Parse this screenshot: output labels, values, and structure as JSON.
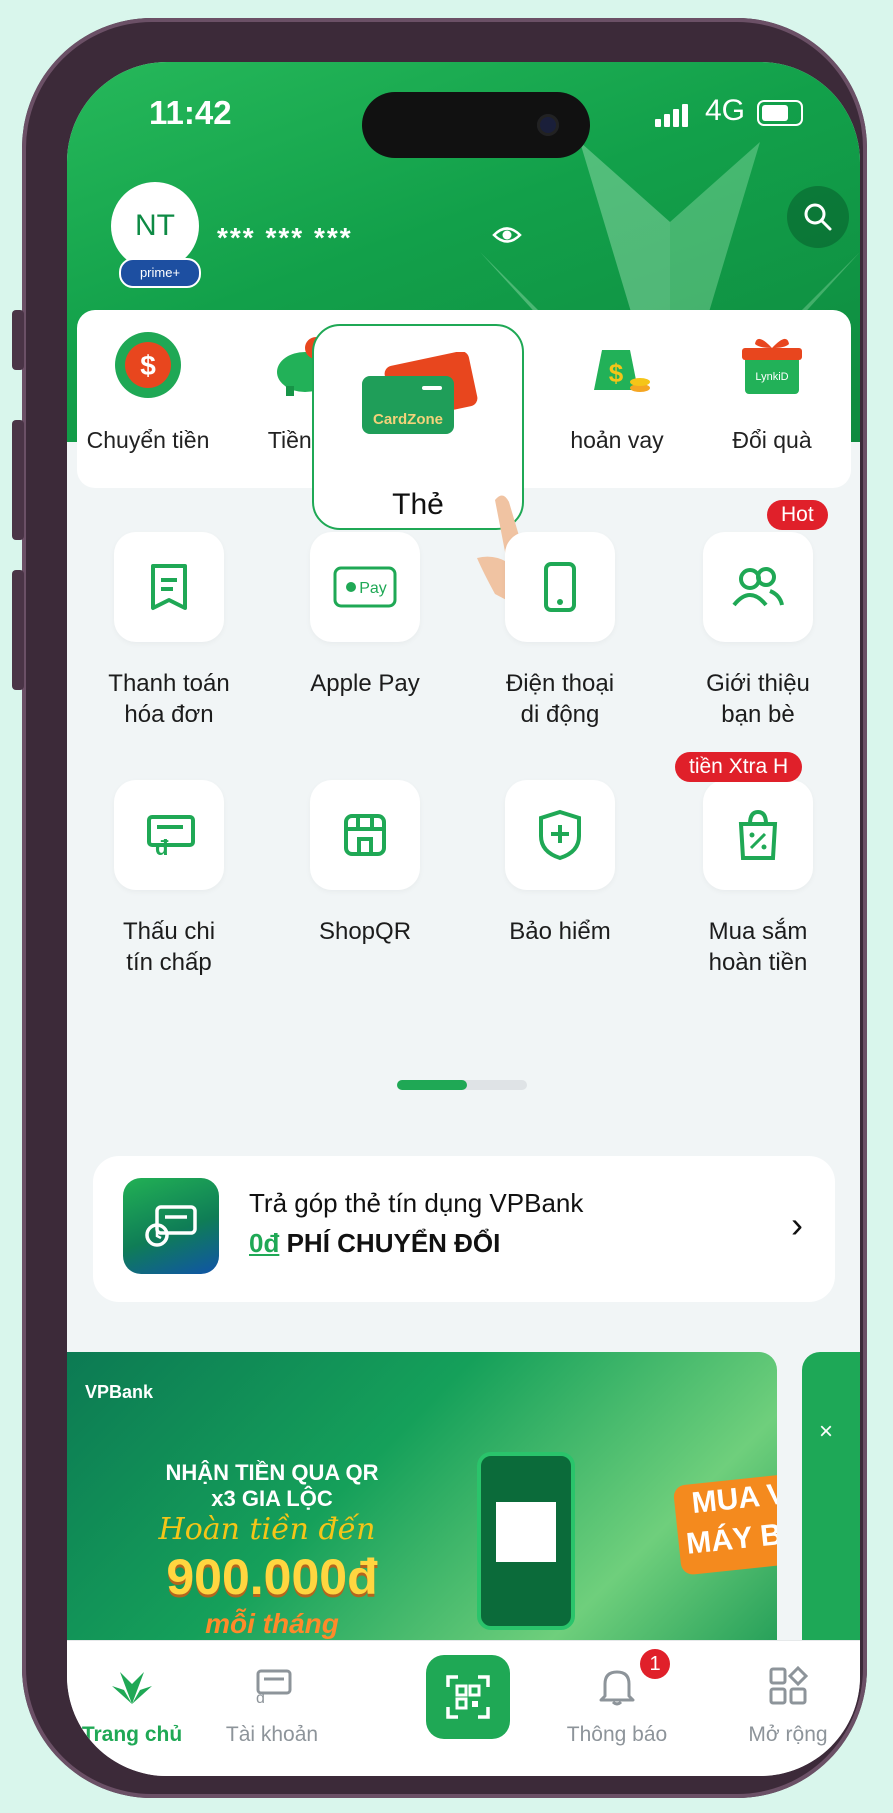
{
  "status_bar": {
    "time": "11:42",
    "network": "4G"
  },
  "header": {
    "avatar_initials": "NT",
    "prime_badge": "prime+",
    "balance_masked": "*** *** ***"
  },
  "quick_actions": [
    {
      "label": "Chuyển tiền",
      "icon": "transfer-icon"
    },
    {
      "label": "Tiền gử",
      "icon": "piggy-bank-icon"
    },
    {
      "label": "hoản vay",
      "icon": "money-bag-icon"
    },
    {
      "label": "Đổi quà",
      "icon": "gift-icon"
    }
  ],
  "card_popup": {
    "label": "Thẻ",
    "card_text": "CardZone"
  },
  "services": [
    {
      "label": "Thanh toán\nhóa đơn",
      "icon": "receipt-icon"
    },
    {
      "label": "Apple Pay",
      "icon": "apple-pay-icon",
      "icon_text": "Pay"
    },
    {
      "label": "Điện thoại\ndi động",
      "icon": "phone-icon"
    },
    {
      "label": "Giới thiệu\nbạn bè",
      "icon": "friends-icon",
      "badge": "Hot"
    },
    {
      "label": "Thấu chi\ntín chấp",
      "icon": "overdraft-icon"
    },
    {
      "label": "ShopQR",
      "icon": "shop-icon"
    },
    {
      "label": "Bảo hiểm",
      "icon": "shield-icon"
    },
    {
      "label": "Mua sắm\nhoàn tiền",
      "icon": "shopping-bag-icon",
      "badge": "tiền Xtra  H"
    }
  ],
  "promo": {
    "line1": "Trả góp thẻ tín dụng VPBank",
    "line2_accent": "0đ",
    "line2": "PHÍ CHUYỂN ĐỔI"
  },
  "banner": {
    "brand": "VPBank",
    "line1": "NHẬN TIỀN QUA QR",
    "line2": "x3 GIA LỘC",
    "line3": "Hoàn tiền đến",
    "amount": "900.000đ",
    "line4": "mỗi tháng",
    "side_text1": "MUA VÉ",
    "side_text2": "MÁY BAY"
  },
  "bottom_nav": [
    {
      "label": "Trang chủ",
      "icon": "home-icon",
      "active": true
    },
    {
      "label": "Tài khoản",
      "icon": "account-icon"
    },
    {
      "label": "",
      "icon": "qr-scan-icon"
    },
    {
      "label": "Thông báo",
      "icon": "bell-icon",
      "badge": "1"
    },
    {
      "label": "Mở rộng",
      "icon": "grid-icon"
    }
  ],
  "colors": {
    "brand_green": "#1fa855",
    "badge_red": "#e0202a"
  }
}
